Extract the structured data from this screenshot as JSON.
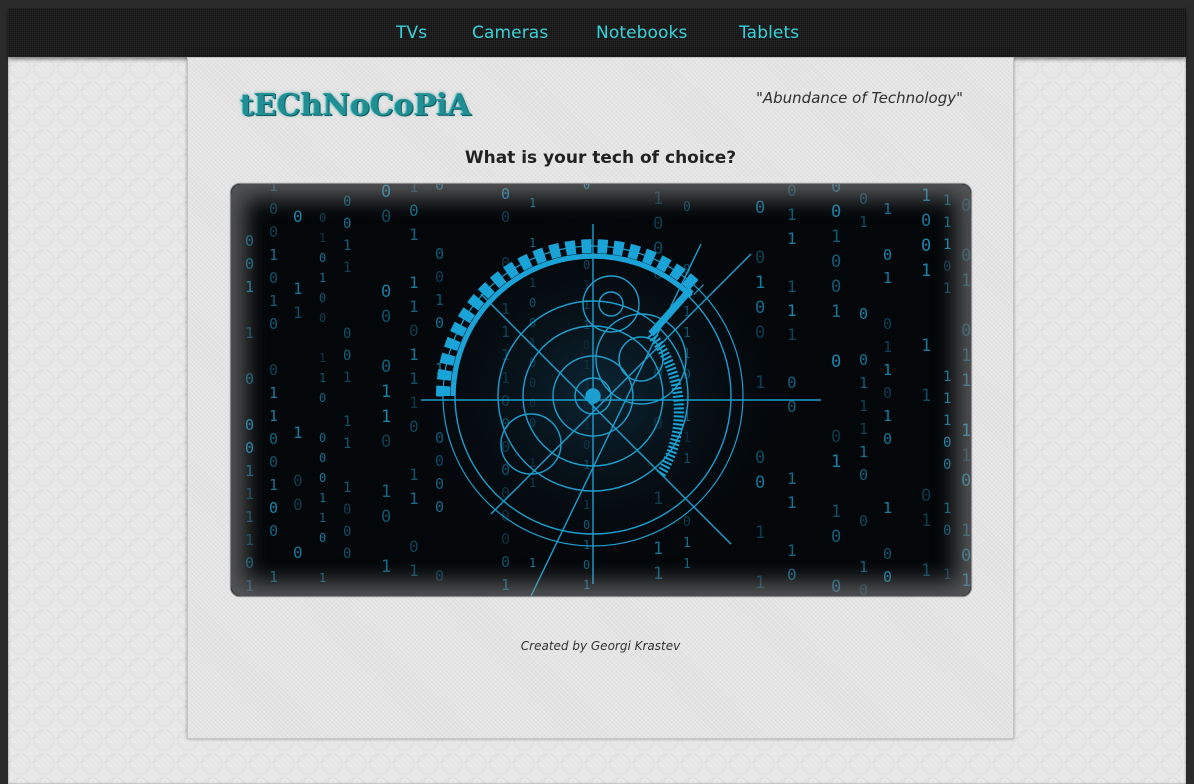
{
  "nav": {
    "items": [
      {
        "label": "TVs"
      },
      {
        "label": "Cameras"
      },
      {
        "label": "Notebooks"
      },
      {
        "label": "Tablets"
      }
    ]
  },
  "header": {
    "logo_text": "tEChNoCoPiA",
    "slogan": "\"Abundance of Technology\""
  },
  "main": {
    "heading": "What is your tech of choice?",
    "hero_image": "binary-gear-hero-icon"
  },
  "footer": {
    "credit": "Created by Georgi Krastev"
  },
  "colors": {
    "nav_link": "#34d4dc",
    "logo": "#1f8f94",
    "hero_accent": "#1aa3d6",
    "nav_bg": "#141414",
    "page_bg": "#e6e6e6"
  }
}
